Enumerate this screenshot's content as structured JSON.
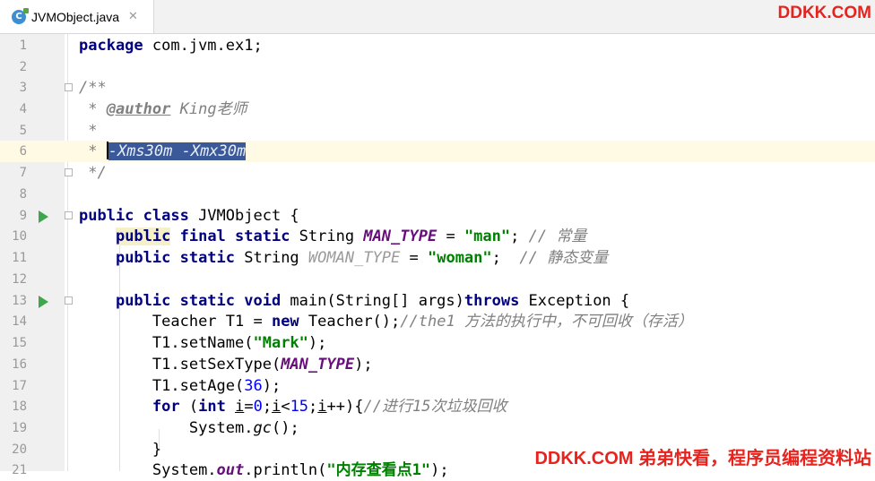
{
  "tab": {
    "icon": "C",
    "filename": "JVMObject.java",
    "close": "✕"
  },
  "watermark": {
    "top": "DDKK.COM",
    "bottom": "DDKK.COM 弟弟快看，程序员编程资料站"
  },
  "lines": [
    {
      "n": "1"
    },
    {
      "n": "2"
    },
    {
      "n": "3"
    },
    {
      "n": "4"
    },
    {
      "n": "5"
    },
    {
      "n": "6"
    },
    {
      "n": "7"
    },
    {
      "n": "8"
    },
    {
      "n": "9"
    },
    {
      "n": "10"
    },
    {
      "n": "11"
    },
    {
      "n": "12"
    },
    {
      "n": "13"
    },
    {
      "n": "14"
    },
    {
      "n": "15"
    },
    {
      "n": "16"
    },
    {
      "n": "17"
    },
    {
      "n": "18"
    },
    {
      "n": "19"
    },
    {
      "n": "20"
    },
    {
      "n": "21"
    }
  ],
  "t": {
    "l1_kw": "package",
    "l1_rest": " com.jvm.ex1;",
    "l3": "/**",
    "l4_star": " * ",
    "l4_tag": "@author",
    "l4_rest": " King老师",
    "l5": " *",
    "l6_star": " * ",
    "l6_sel": "-Xms30m -Xmx30m",
    "l7": " */",
    "l9_kw": "public class",
    "l9_rest": " JVMObject {",
    "l10_ind": "    ",
    "l10_kw1": "public",
    "l10_kw2": " final static",
    "l10_t": " String ",
    "l10_f": "MAN_TYPE",
    "l10_eq": " = ",
    "l10_s": "\"man\"",
    "l10_sc": "; ",
    "l10_c": "// 常量",
    "l11_ind": "    ",
    "l11_kw": "public static",
    "l11_t": " String ",
    "l11_f": "WOMAN_TYPE",
    "l11_eq": " = ",
    "l11_s": "\"woman\"",
    "l11_sc": ";  ",
    "l11_c": "// 静态变量",
    "l13_ind": "    ",
    "l13_kw": "public static void",
    "l13_m": " main(String[] args)",
    "l13_kw2": "throws",
    "l13_rest": " Exception {",
    "l14_ind": "        ",
    "l14_a": "Teacher T1 = ",
    "l14_kw": "new",
    "l14_b": " Teacher();",
    "l14_c": "//the1 方法的执行中，不可回收（存活）",
    "l15_ind": "        ",
    "l15_a": "T1.setName(",
    "l15_s": "\"Mark\"",
    "l15_b": ");",
    "l16_ind": "        ",
    "l16_a": "T1.setSexType(",
    "l16_f": "MAN_TYPE",
    "l16_b": ");",
    "l17_ind": "        ",
    "l17_a": "T1.setAge(",
    "l17_n": "36",
    "l17_b": ");",
    "l18_ind": "        ",
    "l18_kw": "for",
    "l18_a": " (",
    "l18_kw2": "int",
    "l18_sp": " ",
    "l18_i1": "i",
    "l18_eq": "=",
    "l18_n0": "0",
    "l18_s1": ";",
    "l18_i2": "i",
    "l18_lt": "<",
    "l18_n15": "15",
    "l18_s2": ";",
    "l18_i3": "i",
    "l18_b": "++){",
    "l18_c": "//进行15次垃圾回收",
    "l19_ind": "            ",
    "l19_a": "System.",
    "l19_m": "gc",
    "l19_b": "();",
    "l20_ind": "        ",
    "l20": "}",
    "l21_ind": "        ",
    "l21_a": "System.",
    "l21_f": "out",
    "l21_b": ".println(",
    "l21_s": "\"内存查看点1\"",
    "l21_c": ");"
  }
}
